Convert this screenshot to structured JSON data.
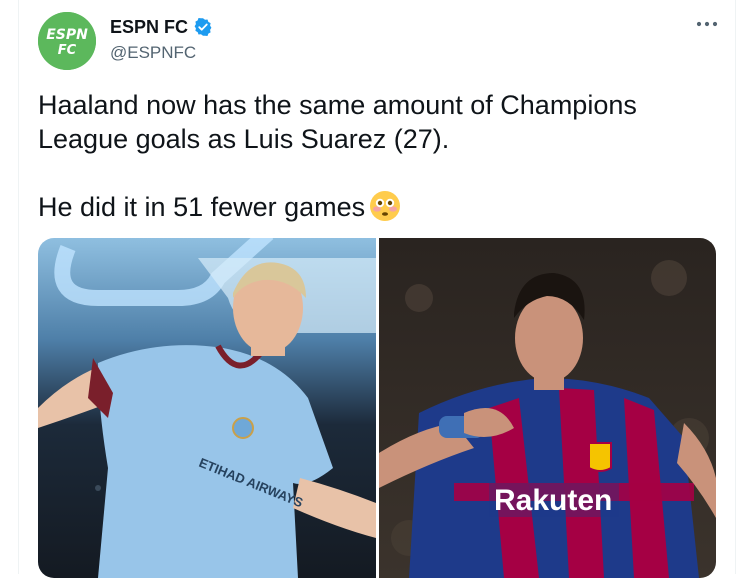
{
  "tweet": {
    "display_name": "ESPN FC",
    "handle": "@ESPNFC",
    "avatar_text": "ESPN FC",
    "line1": "Haaland now has the same amount of Champions League goals as Luis Suarez (27).",
    "line2": "He did it in 51 fewer games",
    "emoji": "flushed-face-emoji"
  },
  "media": {
    "left_shirt_sponsor": "ETIHAD AIRWAYS",
    "right_shirt_sponsor": "Rakuten"
  },
  "colors": {
    "avatar_green": "#5cb85c",
    "verified_blue": "#1d9bf0",
    "handle_gray": "#536471",
    "city_blue": "#98c5e9",
    "barca_blue": "#1e3a8a",
    "barca_red": "#a50044"
  },
  "icons": [
    "verified-badge-icon",
    "more-options-icon"
  ]
}
